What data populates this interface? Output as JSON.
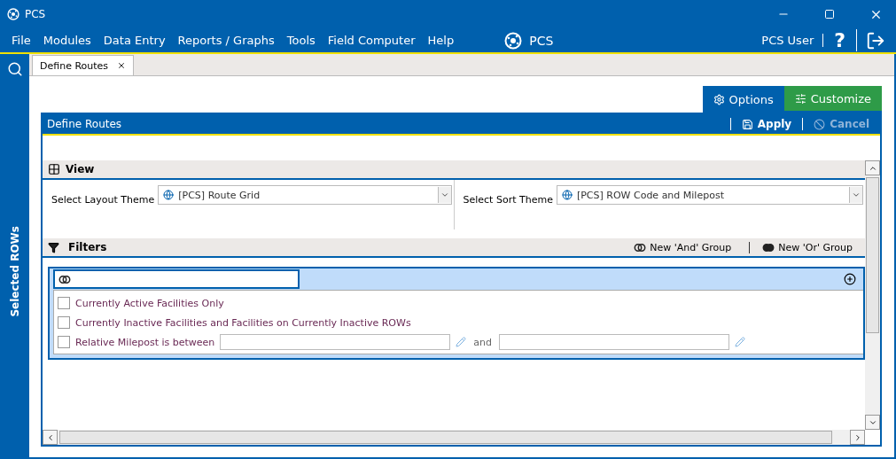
{
  "window": {
    "title": "PCS"
  },
  "menu": [
    "File",
    "Modules",
    "Data Entry",
    "Reports / Graphs",
    "Tools",
    "Field Computer",
    "Help"
  ],
  "app_logo": "PCS",
  "user": "PCS User",
  "help": "?",
  "sidebar": {
    "label": "Selected ROWs"
  },
  "tabs": [
    {
      "label": "Define Routes",
      "selected": true
    }
  ],
  "mode_tabs": [
    {
      "label": "Options",
      "kind": "options",
      "selected": true
    },
    {
      "label": "Customize",
      "kind": "customize",
      "selected": false
    }
  ],
  "panel": {
    "title": "Define Routes",
    "actions": [
      {
        "label": "Apply",
        "kind": "save",
        "disabled": false
      },
      {
        "label": "Cancel",
        "kind": "cancel",
        "disabled": true
      }
    ]
  },
  "view": {
    "title": "View",
    "layout_label": "Select Layout Theme",
    "layout_value": "[PCS] Route Grid",
    "sort_label": "Select Sort Theme",
    "sort_value": "[PCS] ROW Code and Milepost"
  },
  "filters": {
    "title": "Filters",
    "group_buttons": [
      {
        "label": "New 'And' Group",
        "kind": "and"
      },
      {
        "label": "New 'Or' Group",
        "kind": "or"
      }
    ],
    "conditions": [
      {
        "label": "Currently Active Facilities Only",
        "kind": "check",
        "checked": false
      },
      {
        "label": "Currently Inactive Facilities and Facilities on Currently Inactive ROWs",
        "kind": "check",
        "checked": false
      },
      {
        "label": "Relative Milepost is between",
        "kind": "range",
        "checked": false,
        "joiner": "and"
      }
    ]
  }
}
